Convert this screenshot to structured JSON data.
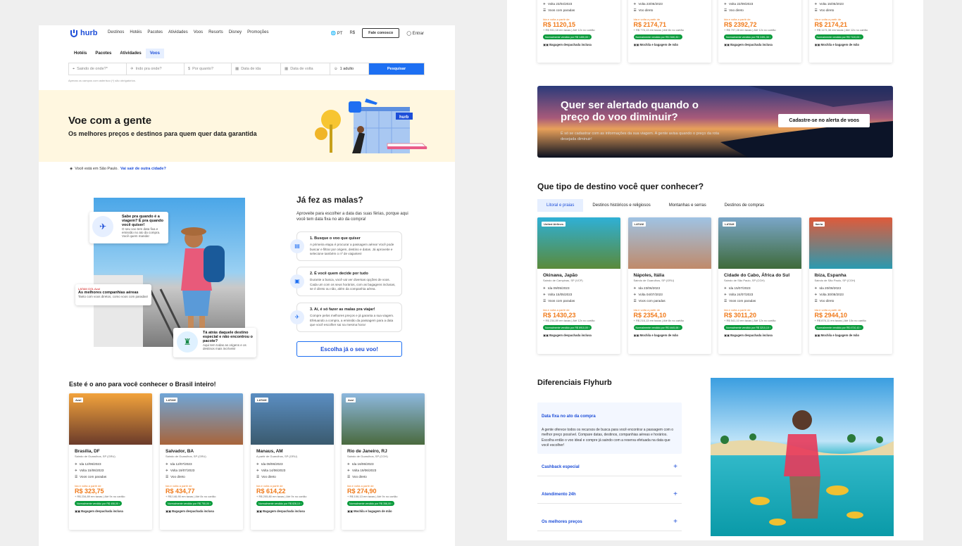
{
  "nav": {
    "brand": "hurb",
    "links": [
      "Destinos",
      "Hotéis",
      "Pacotes",
      "Atividades",
      "Voos",
      "Resorts",
      "Disney",
      "Promoções"
    ],
    "lang": "PT",
    "currency": "R$",
    "contact": "Fale conosco",
    "login": "Entrar"
  },
  "tabs": [
    "Hotéis",
    "Pacotes",
    "Atividades",
    "Voos"
  ],
  "search": {
    "origin": "Saindo de onde?*",
    "dest": "Indo pra onde?",
    "budget": "Por quanto?",
    "depart": "Data de ida",
    "return": "Data de volta",
    "pax": "1 adulto",
    "button": "Pesquisar",
    "hint": "Apenas os campos com asterisco (*) são obrigatórios."
  },
  "hero": {
    "title": "Voe com a gente",
    "subtitle": "Os melhores preços e destinos para quem quer data garantida",
    "sign": "hurb"
  },
  "location": {
    "text": "Você está em São Paulo.",
    "link": "Vai sair de outra cidade?"
  },
  "bubbles": {
    "b1_title": "Sabe pra quando é a viagem? É pra quando você quiser!",
    "b1_text": "O seu voo tem data fixa e emissão no ato da compra. Você quem manda!",
    "b2_logos": "LATAM  GOL  Azul",
    "b2_title": "As melhores companhias aéreas",
    "b2_text": "Tanto com voos diretos, como voos com paradas!",
    "b3_title": "Tá atrás daquele destino especial e não encontrou o pacote?",
    "b3_text": "Aqui tem todas as origens e os destinos mais incríveis!"
  },
  "malas": {
    "title": "Já fez as malas?",
    "subtitle": "Aproveite para escolher a data das suas férias, porque aqui você tem data fixa no ato da compra!",
    "steps": [
      {
        "title": "1. Busque o voo que quiser",
        "text": "A primeira etapa é procurar a passagem aérea! Você pode buscar e filtrar por origem, destino e datas. Já aproveite e selecione também o nº de viajantes!"
      },
      {
        "title": "2. É você quem decide por tudo",
        "text": "Durante a busca, você vai ver diversas opções de voos. Cada um com os seus horários, com as bagagens inclusas, se é direto ou não, além da companhia aérea."
      },
      {
        "title": "3. Aí, é só fazer as malas pra viajar!",
        "text": "Compre pelos melhores preços e já garanta a sua viagem. Efetuando a compra, a emissão da passagem para a data que você escolher sai na mesma hora!"
      }
    ],
    "cta": "Escolha já o seu voo!"
  },
  "brasil": {
    "title": "Este é o ano para você conhecer o Brasil inteiro!",
    "cards": [
      {
        "airline": "Azul",
        "city": "Brasília, DF",
        "origin": "Saindo de Guarulhos, SP (GRU)",
        "ida": "Ida 12/06/2023",
        "volta": "Volta 15/06/2023",
        "stops": "Voos com paradas",
        "from": "Ida e volta a partir de",
        "price": "R$ 323,75",
        "tax": "+ R$ 234,89 em taxas | Até 9x no cartão",
        "badge": "Normalmente vendido por R$ 408,00 ›",
        "bag": "Bagagem despachada inclusa",
        "c1": "#f2a33c",
        "c2": "#6b3b2a"
      },
      {
        "airline": "LATAM",
        "city": "Salvador, BA",
        "origin": "Saindo de Guarulhos, SP (GRU)",
        "ida": "Ida 12/07/2023",
        "volta": "Volta 19/07/2023",
        "stops": "Voo direto",
        "from": "Ida e volta a partir de",
        "price": "R$ 434,77",
        "tax": "+ R$ 146,90 em taxas | Até 8x no cartão",
        "badge": "Normalmente vendido por R$ 750,00 ›",
        "bag": "Bagagem despachada inclusa",
        "c1": "#6fa6d8",
        "c2": "#a8643a"
      },
      {
        "airline": "LATAM",
        "city": "Manaus, AM",
        "origin": "A partir de Guarulhos, SP (GRU)",
        "ida": "Ida 08/06/2023",
        "volta": "Volta 14/06/2023",
        "stops": "Voo direto",
        "from": "Ida e volta a partir de",
        "price": "R$ 614,22",
        "tax": "+ R$ 205,80 em taxas | Até 9x no cartão",
        "badge": "Normalmente vendido por R$ 828,10 ›",
        "bag": "Bagagem despachada inclusa",
        "c1": "#5b8ec2",
        "c2": "#3a5a6e"
      },
      {
        "airline": "Azul",
        "city": "Rio de Janeiro, RJ",
        "origin": "Saindo de Guarulhos, SP (CGH)",
        "ida": "Ida 16/06/2023",
        "volta": "Volta 19/06/2023",
        "stops": "Voo direto",
        "from": "Ida e volta a partir de",
        "price": "R$ 274,90",
        "tax": "+ R$ 106,13 em taxas | Até 9x no cartão",
        "badge": "Normalmente vendido por R$ 358,00 ›",
        "bag": "Mochila e bagagem de mão",
        "c1": "#8db8de",
        "c2": "#4a6a3e"
      }
    ]
  },
  "topcards": [
    {
      "volta": "Volta 23/04/2023",
      "stops": "Voos com paradas",
      "from": "Ida e volta a partir de",
      "price": "R$ 1120,15",
      "tax": "+ R$ 931,18 em taxas | Até 12x no cartão",
      "badge": "Normalmente vendido por R$ 1450,00 ›",
      "bag": "Bagagem despachada inclusa"
    },
    {
      "volta": "Volta 23/06/2023",
      "stops": "Voo direto",
      "from": "Ida e volta a partir de",
      "price": "R$ 2174,71",
      "tax": "+ R$ 776,13 em taxas | Até 8x no cartão",
      "badge": "Normalmente vendido por R$ 2180,30 ›",
      "bag": "Mochila e bagagem de mão"
    },
    {
      "volta": "Volta 22/09/2023",
      "stops": "Voo direto",
      "from": "Ida e volta a partir de",
      "price": "R$ 2392,72",
      "tax": "+ R$ 797,28 em taxas | Até 12x no cartão",
      "badge": "Normalmente vendido por R$ 2491,30 ›",
      "bag": "Bagagem despachada inclusa"
    },
    {
      "volta": "Volta 15/05/2023",
      "stops": "Voo direto",
      "from": "Ida e volta a partir de",
      "price": "R$ 2174,21",
      "tax": "+ R$ 1171,36 em taxas | Até 12x no cartão",
      "badge": "Normalmente vendido por R$ 7120,00 ›",
      "bag": "Mochila e bagagem de mão"
    }
  ],
  "alert": {
    "title": "Quer ser alertado quando o preço do voo diminuir?",
    "text": "É só se cadastrar com as informações da sua viagem. A gente avisa quando o preço da rota desejada diminuir!",
    "button": "Cadastre-se no alerta de voos"
  },
  "destinos": {
    "title": "Que tipo de destino você quer conhecer?",
    "tabs": [
      "Litoral e praias",
      "Destinos históricos e religiosos",
      "Montanhas e serras",
      "Destinos de compras"
    ],
    "cards": [
      {
        "airline": "United Airlines",
        "city": "Okinawa, Japão",
        "origin": "Saindo de Campinas, SP (VCP)",
        "ida": "Ida 09/05/2023",
        "volta": "Volta 15/05/2023",
        "stops": "Voos com paradas",
        "from": "Ida e volta a partir de",
        "price": "R$ 1430,23",
        "tax": "+ R$ 234,89 em taxas | Até 12x no cartão",
        "badge": "Normalmente vendido por R$ 6910,00 ›",
        "bag": "Bagagem despachada inclusa",
        "c1": "#2fb0d6",
        "c2": "#5a8a3a"
      },
      {
        "airline": "LATAM",
        "city": "Nápoles, Itália",
        "origin": "Saindo de Guarulhos, SP (GRU)",
        "ida": "Ida 23/06/2023",
        "volta": "Volta 04/07/2023",
        "stops": "Voos com paradas",
        "from": "Ida e volta a partir de",
        "price": "R$ 2354,10",
        "tax": "+ R$ 216,13 em taxas | Até 8x no cartão",
        "badge": "Normalmente vendido por R$ 4445,58 ›",
        "bag": "Mochila e bagagem de mão",
        "c1": "#9fc3e4",
        "c2": "#c08a6a"
      },
      {
        "airline": "LATAM",
        "city": "Cidade do Cabo, África do Sul",
        "origin": "Saindo de São Paulo, SP (CGH)",
        "ida": "Ida 15/07/2023",
        "volta": "Volta 24/07/2023",
        "stops": "Voos com paradas",
        "from": "Ida e volta a partir de",
        "price": "R$ 3011,20",
        "tax": "+ R$ 541,10 em taxas | Até 12x no cartão",
        "badge": "Normalmente vendido por R$ 3210,10 ›",
        "bag": "Bagagem despachada inclusa",
        "c1": "#7aa6c8",
        "c2": "#3e6a3a"
      },
      {
        "airline": "Iberia",
        "city": "Ibiza, Espanha",
        "origin": "Saindo de São Paulo, SP (CGH)",
        "ida": "Ida 20/08/2023",
        "volta": "Volta 30/08/2023",
        "stops": "Voo direto",
        "from": "Ida e volta a partir de",
        "price": "R$ 2944,10",
        "tax": "+ R$ 876,11 em taxas | Até 10x no cartão",
        "badge": "Normalmente vendido por R$ 4710,10 ›",
        "bag": "Mochila e bagagem de mão",
        "c1": "#e05a3a",
        "c2": "#2a9ab0"
      }
    ]
  },
  "diferenciais": {
    "title": "Diferenciais Flyhurb",
    "open_title": "Data fixa no ato da compra",
    "open_text": "A gente oferece todos os recursos de busca para você encontrar a passagem com o melhor preço possível. Compare datas, destinos, companhias aéreas e horários. Escolha então o voo ideal e compre já saindo com a reserva efetuada na data que você escolher!",
    "items": [
      "Cashback especial",
      "Atendimento 24h",
      "Os melhores preços"
    ]
  },
  "colors": {
    "primary": "#1d6ff2",
    "price": "#f07a1a",
    "badge": "#0a9b3c",
    "hero_bg": "#fff7e0"
  }
}
